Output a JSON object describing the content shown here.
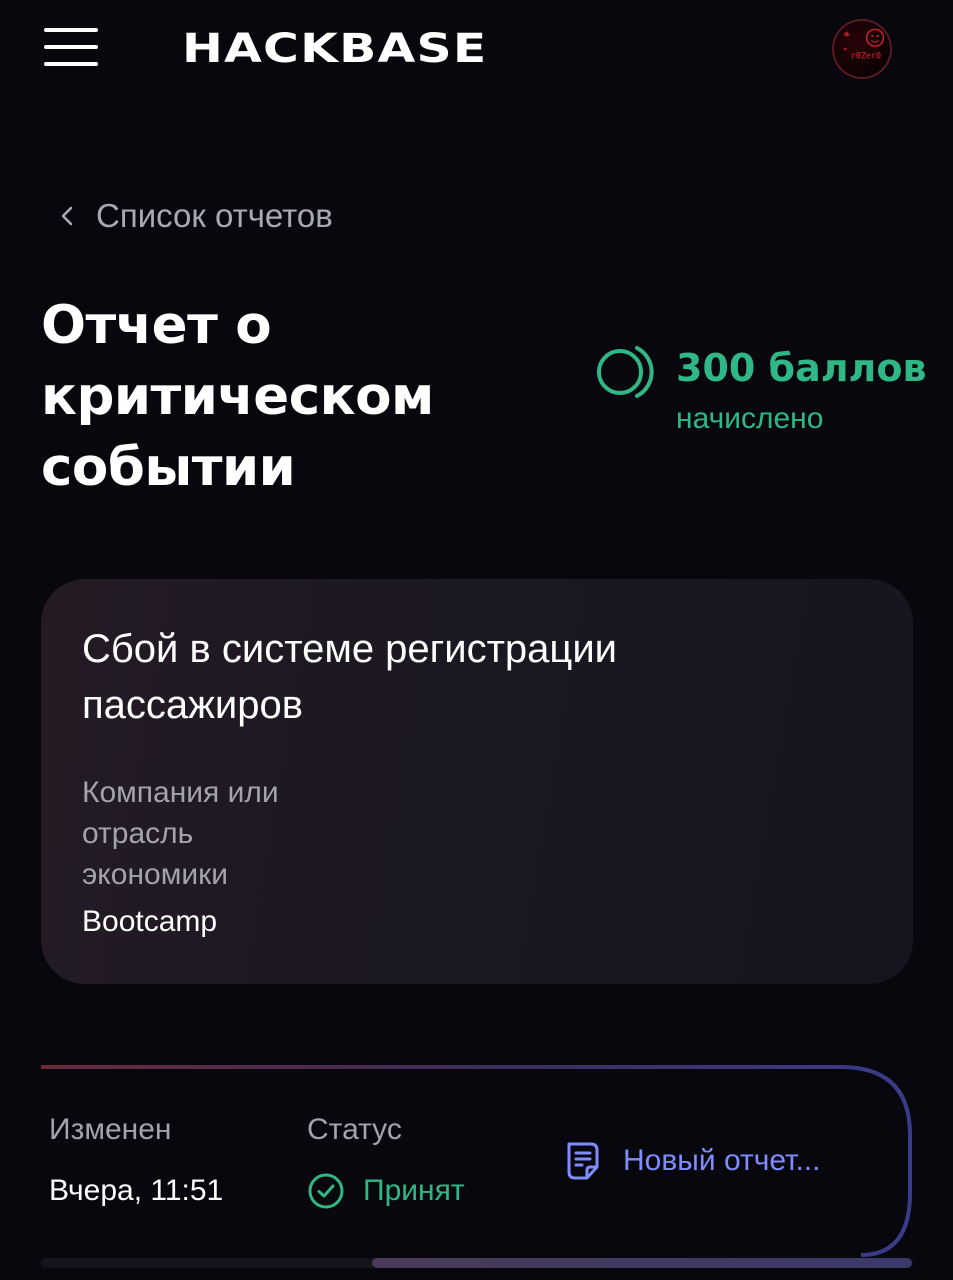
{
  "header": {
    "logo": "HACKBASE",
    "avatar_text": "r0Zer0"
  },
  "breadcrumb": {
    "label": "Список отчетов"
  },
  "title": "Отчет о критическом событии",
  "points": {
    "value": "300 баллов",
    "sub": "начислено"
  },
  "card": {
    "title": "Сбой в системе регистрации пассажиров",
    "field_label": "Компания или отрасль экономики",
    "field_value": "Bootcamp"
  },
  "details": {
    "changed_label": "Изменен",
    "changed_value": "Вчера, 11:51",
    "status_label": "Статус",
    "status_value": "Принят",
    "new_report_label": "Новый отчет..."
  },
  "colors": {
    "background": "#07070d",
    "accent_green": "#2fb886",
    "link_blue": "#7f8cff",
    "muted_text": "#a6a8b2"
  },
  "icons": {
    "menu": "hamburger-icon",
    "back": "chevron-left-icon",
    "points": "points-ring-icon",
    "status": "check-circle-icon",
    "new_report": "document-icon"
  }
}
